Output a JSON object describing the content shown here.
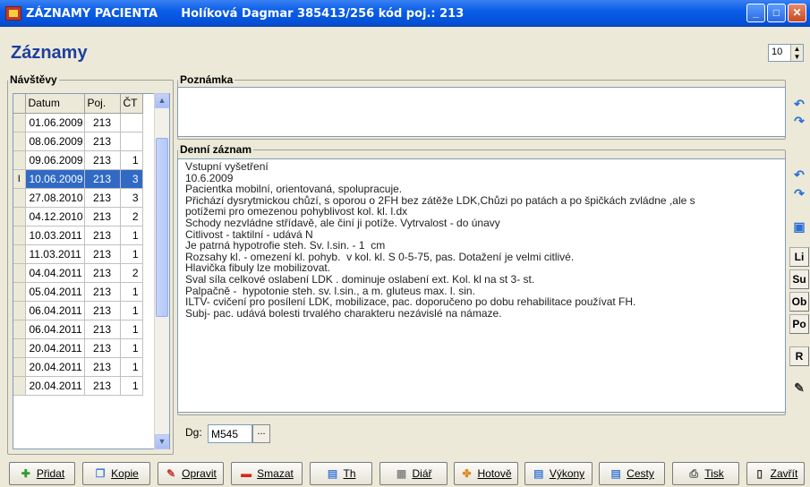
{
  "window": {
    "title": "ZÁZNAMY PACIENTA",
    "patient_info": "Holíková Dagmar   385413/256  kód poj.: 213",
    "min_label": "_",
    "max_label": "□",
    "close_label": "✕"
  },
  "page_title": "Záznamy",
  "page_count": {
    "value": "10"
  },
  "visits": {
    "legend": "Návštěvy",
    "columns": [
      "Datum",
      "Poj.",
      "ČT"
    ],
    "rows": [
      {
        "date": "01.06.2009",
        "poj": "213",
        "ct": ""
      },
      {
        "date": "08.06.2009",
        "poj": "213",
        "ct": ""
      },
      {
        "date": "09.06.2009",
        "poj": "213",
        "ct": "1"
      },
      {
        "date": "10.06.2009",
        "poj": "213",
        "ct": "3",
        "selected": true
      },
      {
        "date": "27.08.2010",
        "poj": "213",
        "ct": "3"
      },
      {
        "date": "04.12.2010",
        "poj": "213",
        "ct": "2"
      },
      {
        "date": "10.03.2011",
        "poj": "213",
        "ct": "1"
      },
      {
        "date": "11.03.2011",
        "poj": "213",
        "ct": "1"
      },
      {
        "date": "04.04.2011",
        "poj": "213",
        "ct": "2"
      },
      {
        "date": "05.04.2011",
        "poj": "213",
        "ct": "1"
      },
      {
        "date": "06.04.2011",
        "poj": "213",
        "ct": "1"
      },
      {
        "date": "06.04.2011",
        "poj": "213",
        "ct": "1"
      },
      {
        "date": "20.04.2011",
        "poj": "213",
        "ct": "1"
      },
      {
        "date": "20.04.2011",
        "poj": "213",
        "ct": "1"
      },
      {
        "date": "20.04.2011",
        "poj": "213",
        "ct": "1"
      }
    ],
    "row_cursor": "I"
  },
  "note": {
    "legend": "Poznámka",
    "value": ""
  },
  "daily_record": {
    "legend": "Denní záznam",
    "lines": [
      "Vstupní vyšetření",
      "10.6.2009",
      "Pacientka mobilní, orientovaná, spolupracuje.",
      "Přichází dysrytmickou chůzí, s oporou o 2FH bez zátěže LDK,Chůzi po patách a po špičkách zvládne ,ale s",
      "potížemi pro omezenou pohyblivost kol. kl. l.dx",
      "Schody nezvládne střídavě, ale činí ji potíže. Vytrvalost - do únavy",
      "Citlivost - taktilní - udává N",
      "Je patrná hypotrofie steh. Sv. l.sin. - 1  cm",
      "Rozsahy kl. - omezení kl. pohyb.  v kol. kl. S 0-5-75, pas. Dotažení je velmi citlivé.",
      "Hlavička fibuly lze mobilizovat.",
      "Sval síla celkové oslabení LDK . dominuje oslabení ext. Kol. kl na st 3- st.",
      "Palpačně -  hypotonie steh. sv. l.sin., a m. gluteus max. l. sin.",
      "ILTV- cvičení pro posílení LDK, mobilizace, pac. doporučeno po dobu rehabilitace používat FH.",
      "Subj- pac. udává bolesti trvalého charakteru nezávislé na námaze."
    ]
  },
  "side_buttons": [
    "Li",
    "Su",
    "Ob",
    "Po",
    "R"
  ],
  "diagnosis": {
    "label": "Dg:",
    "value": "M545",
    "browse_label": "..."
  },
  "toolbar": [
    {
      "name": "add-button",
      "label": "Přidat",
      "icon": "plus-icon",
      "color": "#2e9e2e"
    },
    {
      "name": "copy-button",
      "label": "Kopie",
      "icon": "copy-icon",
      "color": "#4a7fd4"
    },
    {
      "name": "edit-button",
      "label": "Opravit",
      "icon": "pencil-icon",
      "color": "#c0392b"
    },
    {
      "name": "delete-button",
      "label": "Smazat",
      "icon": "minus-icon",
      "color": "#d9261c"
    },
    {
      "name": "th-button",
      "label": "Th",
      "icon": "grid-icon",
      "color": "#4a7fd4"
    },
    {
      "name": "diary-button",
      "label": "Diář",
      "icon": "calendar-icon",
      "color": "#8a8a8a"
    },
    {
      "name": "done-button",
      "label": "Hotově",
      "icon": "puzzle-icon",
      "color": "#e08a1e"
    },
    {
      "name": "procedures-button",
      "label": "Výkony",
      "icon": "grid-icon",
      "color": "#4a7fd4"
    },
    {
      "name": "trips-button",
      "label": "Cesty",
      "icon": "grid-icon",
      "color": "#4a7fd4"
    },
    {
      "name": "print-button",
      "label": "Tisk",
      "icon": "printer-icon",
      "color": "#555555"
    },
    {
      "name": "close-button",
      "label": "Zavřít",
      "icon": "door-icon",
      "color": "#333333"
    }
  ]
}
